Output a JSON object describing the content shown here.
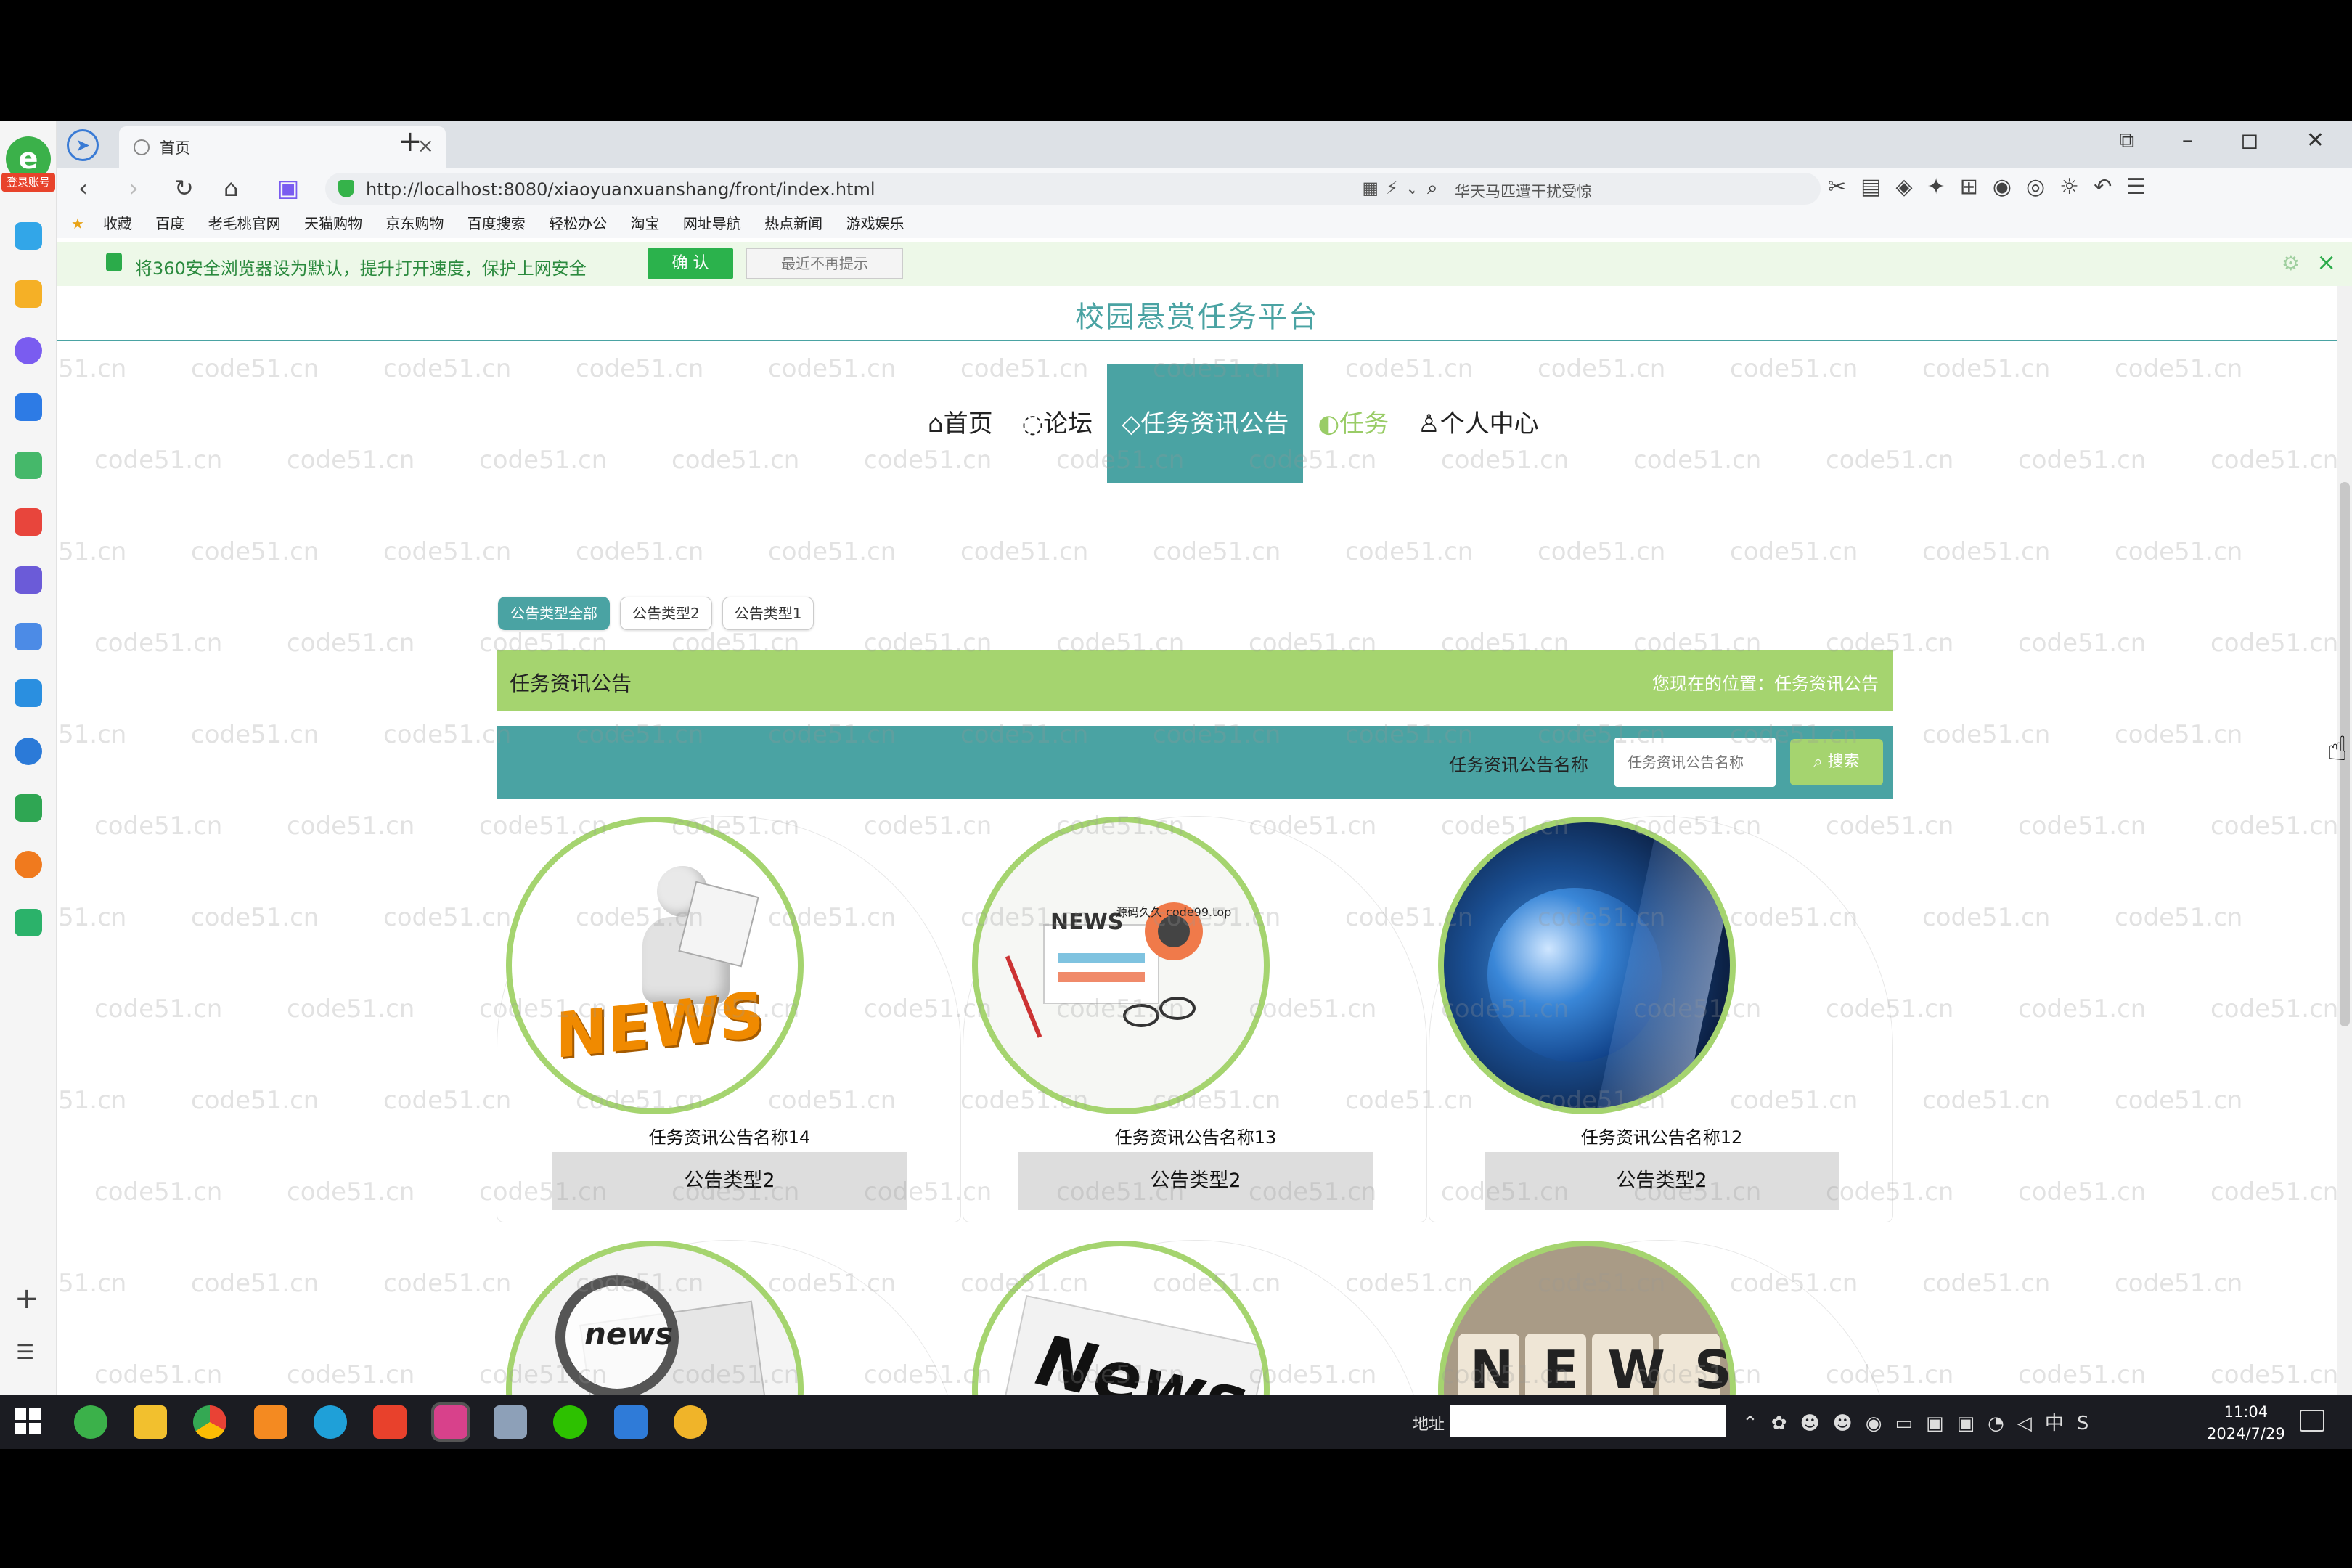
{
  "browser": {
    "tab_title": "首页",
    "new_tab": "+",
    "url": "http://localhost:8080/xiaoyuanxuanshang/front/index.html",
    "search_text": "华天马匹遭干扰受惊",
    "window_controls": [
      "minimize",
      "restore",
      "close"
    ],
    "side_badge": "登录账号",
    "bookmarks": [
      "收藏",
      "百度",
      "老毛桃官网",
      "天猫购物",
      "京东购物",
      "百度搜索",
      "轻松办公",
      "淘宝",
      "网址导航",
      "热点新闻",
      "游戏娱乐"
    ],
    "security_banner": {
      "text": "将360安全浏览器设为默认，提升打开速度，保护上网安全",
      "confirm": "确 认",
      "dismiss": "最近不再提示"
    }
  },
  "site": {
    "title": "校园悬赏任务平台",
    "nav": [
      {
        "label": "首页",
        "icon": "home-icon"
      },
      {
        "label": "论坛",
        "icon": "forum-icon"
      },
      {
        "label": "任务资讯公告",
        "icon": "tag-icon",
        "active": true
      },
      {
        "label": "任务",
        "icon": "task-icon"
      },
      {
        "label": "个人中心",
        "icon": "user-icon"
      }
    ],
    "category_tabs": [
      "公告类型全部",
      "公告类型2",
      "公告类型1"
    ],
    "section_title": "任务资讯公告",
    "location": "您现在的位置：任务资讯公告",
    "search": {
      "label": "任务资讯公告名称",
      "placeholder": "任务资讯公告名称",
      "button": "搜索"
    },
    "cards": [
      {
        "title": "任务资讯公告名称14",
        "type": "公告类型2",
        "image": "news-reader-3d-figure"
      },
      {
        "title": "任务资讯公告名称13",
        "type": "公告类型2",
        "image": "news-illustration-glasses",
        "overlay_text": "源码久久 code99.top"
      },
      {
        "title": "任务资讯公告名称12",
        "type": "公告类型2",
        "image": "globe-news-broadcast"
      },
      {
        "title": "",
        "type": "",
        "image": "magnifier-news-paper"
      },
      {
        "title": "",
        "type": "",
        "image": "news-newspaper"
      },
      {
        "title": "",
        "type": "",
        "image": "news-wooden-cubes"
      }
    ],
    "watermark": "code51.cn"
  },
  "taskbar": {
    "address_label": "地址",
    "ime": "中",
    "time": "11:04",
    "date": "2024/7/29"
  },
  "colors": {
    "teal": "#4aa3a3",
    "green": "#a5d46f",
    "circle_border": "#a5d46f"
  }
}
